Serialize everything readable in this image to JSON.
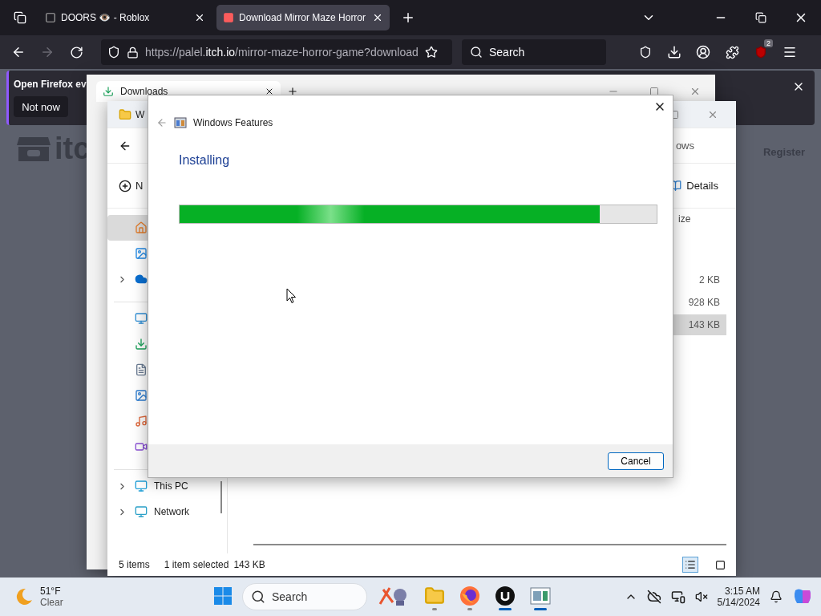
{
  "browser": {
    "tabs": [
      {
        "title": "DOORS 👁️ - Roblox",
        "selected": false,
        "kind": "roblox"
      },
      {
        "title": "Download Mirror Maze Horror",
        "selected": true,
        "kind": "itch"
      }
    ],
    "url": {
      "prefix": "https://palel.",
      "domain": "itch.io",
      "path": "/mirror-maze-horror-game?download"
    },
    "search_placeholder": "Search",
    "extension_badge": "2"
  },
  "notification": {
    "message": "Open Firefox ev",
    "button": "Not now"
  },
  "page": {
    "logo": "itc",
    "register": "Register"
  },
  "downloads_window": {
    "title": "Downloads"
  },
  "explorer": {
    "title": "W",
    "breadcrumb": "ows",
    "new_button": "N",
    "view_button": "Details",
    "column": "ize",
    "files": [
      {
        "size": "2 KB",
        "selected": false
      },
      {
        "size": "928 KB",
        "selected": false
      },
      {
        "size": "143 KB",
        "selected": true
      }
    ],
    "nav": [
      {
        "kind": "home",
        "selected": true,
        "expandable": false
      },
      {
        "kind": "gallery",
        "selected": false,
        "expandable": false
      },
      {
        "kind": "onedrive",
        "selected": false,
        "expandable": true
      },
      {
        "kind": "divider"
      },
      {
        "kind": "desktop",
        "selected": false,
        "expandable": false
      },
      {
        "kind": "downloads",
        "selected": false,
        "expandable": false
      },
      {
        "kind": "documents",
        "selected": false,
        "expandable": false
      },
      {
        "kind": "pictures",
        "selected": false,
        "expandable": false
      },
      {
        "kind": "music",
        "selected": false,
        "expandable": false
      },
      {
        "kind": "videos",
        "selected": false,
        "expandable": false
      },
      {
        "kind": "divider"
      },
      {
        "kind": "pc",
        "label": "This PC",
        "selected": false,
        "expandable": true
      },
      {
        "kind": "network",
        "label": "Network",
        "selected": false,
        "expandable": true
      }
    ],
    "status": {
      "items": "5 items",
      "selection": "1 item selected",
      "size": "143 KB"
    }
  },
  "dialog": {
    "title": "Windows Features",
    "heading": "Installing",
    "level": 0.88,
    "button": "Cancel"
  },
  "taskbar": {
    "temperature": "51°F",
    "condition": "Clear",
    "search_placeholder": "Search",
    "apps": [
      {
        "kind": "widget",
        "selected": false,
        "running": false
      },
      {
        "kind": "explorer",
        "selected": false,
        "running": true
      },
      {
        "kind": "firefox",
        "selected": false,
        "running": true
      },
      {
        "kind": "unreal",
        "selected": true,
        "running": true
      },
      {
        "kind": "app",
        "selected": true,
        "running": true
      }
    ],
    "time": "3:15 AM",
    "date": "5/14/2024"
  }
}
